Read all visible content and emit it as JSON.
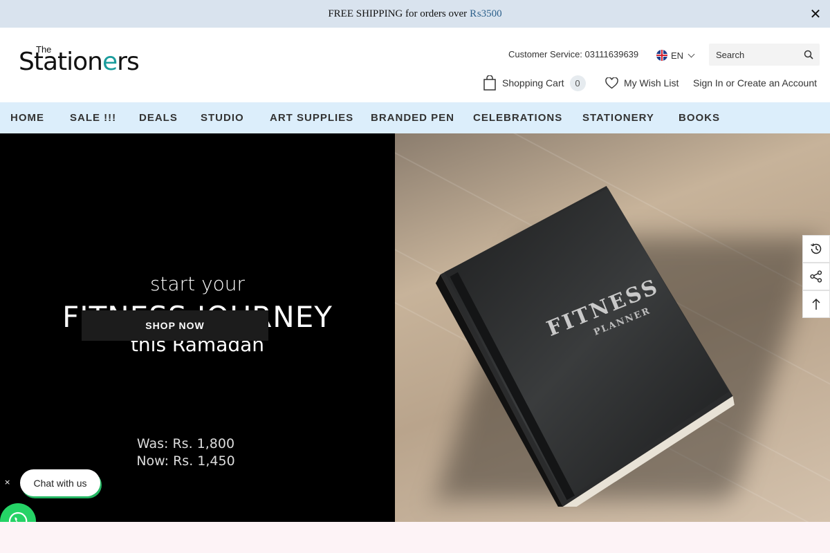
{
  "announcement": {
    "text": "FREE SHIPPING for orders over",
    "amount": "₨3500",
    "close_icon": "close-icon"
  },
  "logo": {
    "the": "The",
    "word_start": "Station",
    "word_accent": "e",
    "word_end": "rs"
  },
  "header": {
    "customer_service": "Customer Service: 03111639639",
    "language": "EN",
    "search_placeholder": "Search",
    "cart_label": "Shopping Cart",
    "cart_count": "0",
    "wishlist_label": "My Wish List",
    "account_label": "Sign In or Create an Account"
  },
  "nav": {
    "items": [
      "HOME",
      "SALE !!!",
      "DEALS",
      "STUDIO",
      "ART SUPPLIES",
      "BRANDED PEN",
      "CELEBRATIONS",
      "STATIONERY",
      "BOOKS"
    ]
  },
  "hero": {
    "line1": "start your",
    "line2": "FITNESS JOURNEY",
    "line3": "this Ramadan",
    "was": "Was:  Rs. 1,800",
    "now": "Now: Rs. 1,450",
    "shop_now": "SHOP NOW",
    "book_title": "FITNESS",
    "book_subtitle": "PLANNER"
  },
  "side_buttons": [
    "history-icon",
    "share-icon",
    "arrow-up-icon"
  ],
  "chat": {
    "close": "×",
    "label": "Chat with us"
  },
  "colors": {
    "announcement_bg": "#d9e3ee",
    "nav_bg": "#dceefb",
    "logo_accent": "#1a9c9c",
    "whatsapp": "#25d366"
  }
}
